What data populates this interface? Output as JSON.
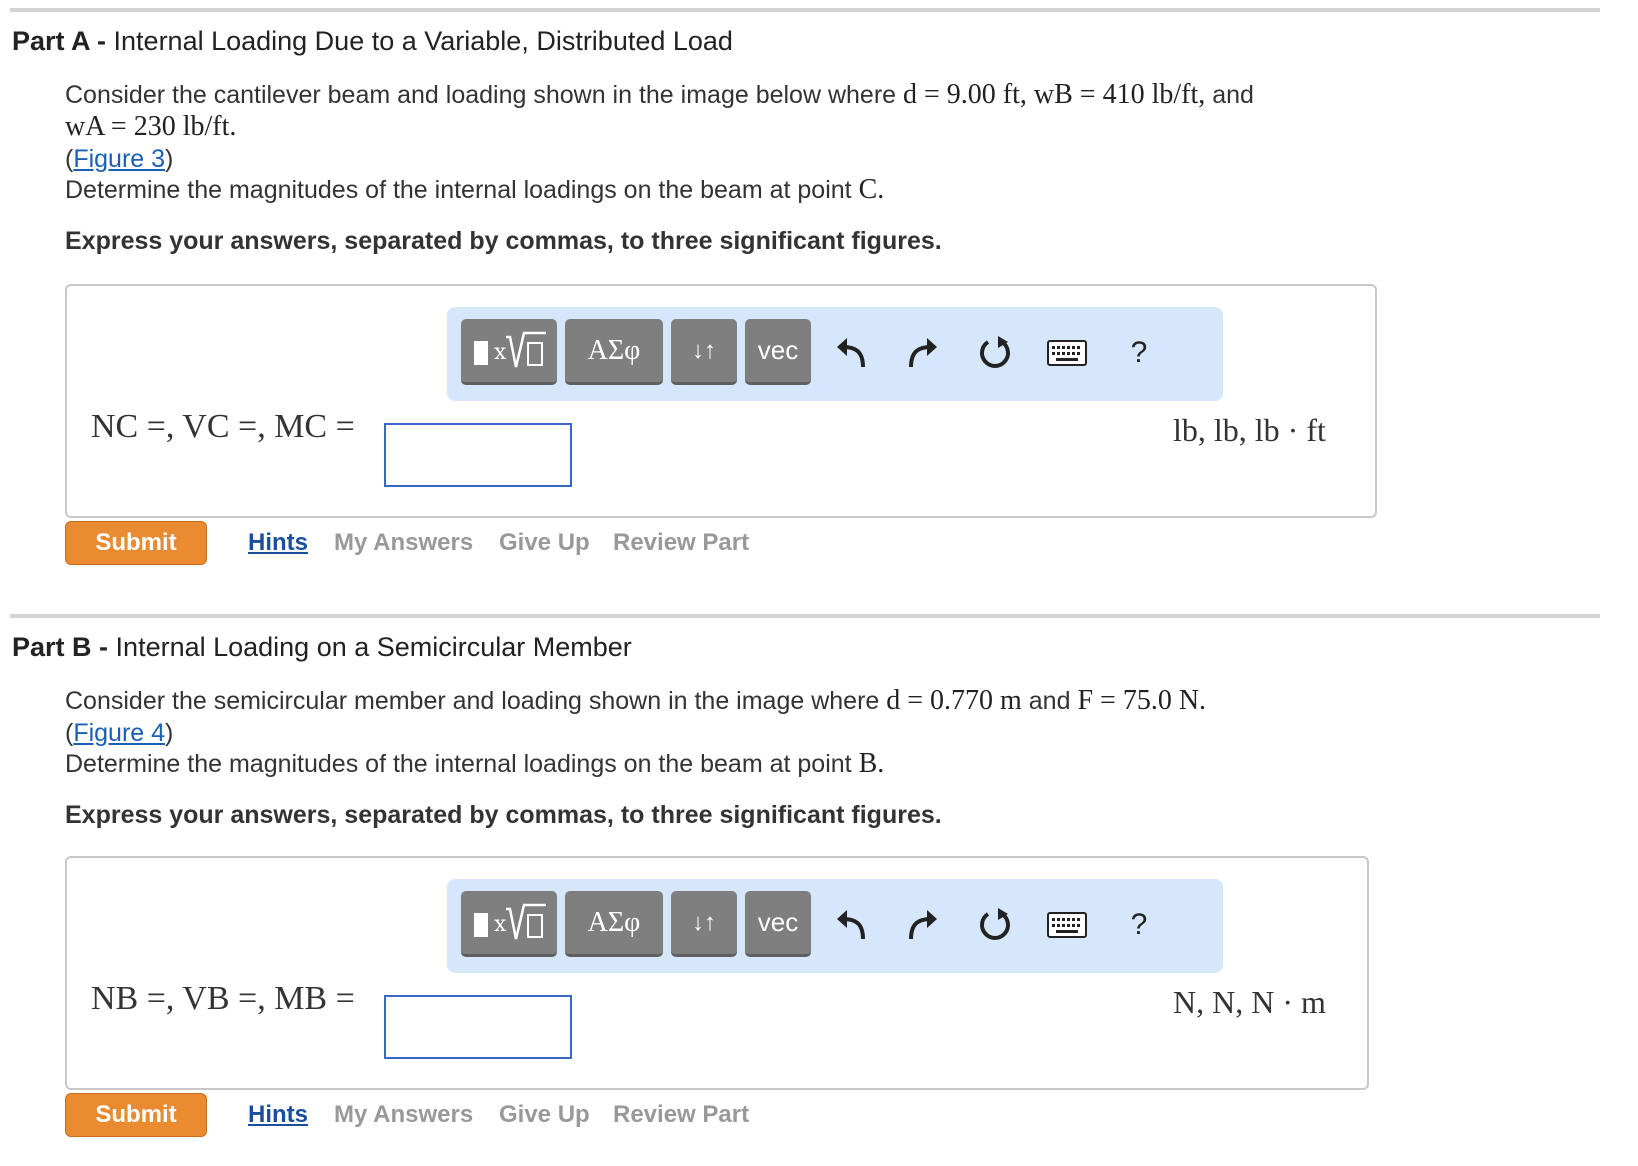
{
  "part_a": {
    "heading_prefix": "Part A -",
    "heading_title": "Internal Loading Due to a Variable, Distributed Load",
    "intro_text": "Consider the cantilever beam and loading shown in the image below where",
    "given_d": "d = 9.00 ft,",
    "given_wb": "wB = 410 lb/ft,",
    "and_text": "and",
    "given_wa": "wA = 230 lb/ft.",
    "figure_open": "(",
    "figure_link": "Figure 3",
    "figure_close": ")",
    "task_text": "Determine the magnitudes of the internal loadings on the beam at point",
    "point": "C.",
    "instruction": "Express your answers, separated by commas, to three significant figures.",
    "answer_label": "NC =, VC =, MC =",
    "units": "lb, lb, lb · ft",
    "input_value": ""
  },
  "part_b": {
    "heading_prefix": "Part B -",
    "heading_title": "Internal Loading on a Semicircular Member",
    "intro_text": "Consider the semicircular member and loading shown in the image where",
    "given_d": "d = 0.770 m",
    "and_text": "and",
    "given_f": "F = 75.0 N.",
    "figure_open": "(",
    "figure_link": "Figure 4",
    "figure_close": ")",
    "task_text": "Determine the magnitudes of the internal loadings on the beam at point",
    "point": "B.",
    "instruction": "Express your answers, separated by commas, to three significant figures.",
    "answer_label": "NB =, VB =, MB =",
    "units": "N, N, N · m",
    "input_value": ""
  },
  "toolbar": {
    "greek_label": "ΑΣφ",
    "arrows_label": "↓↑",
    "vec_label": "vec",
    "help_label": "?",
    "icons": [
      "templates-icon",
      "undo-icon",
      "redo-icon",
      "reset-icon",
      "keyboard-icon"
    ]
  },
  "actions": {
    "submit": "Submit",
    "hints": "Hints",
    "my_answers": "My Answers",
    "give_up": "Give Up",
    "review_part": "Review Part"
  },
  "colors": {
    "submit_bg": "#ea8a31",
    "toolbar_bg": "#d6e6fb",
    "link": "#1a5fb4",
    "input_border": "#3a66c8"
  }
}
